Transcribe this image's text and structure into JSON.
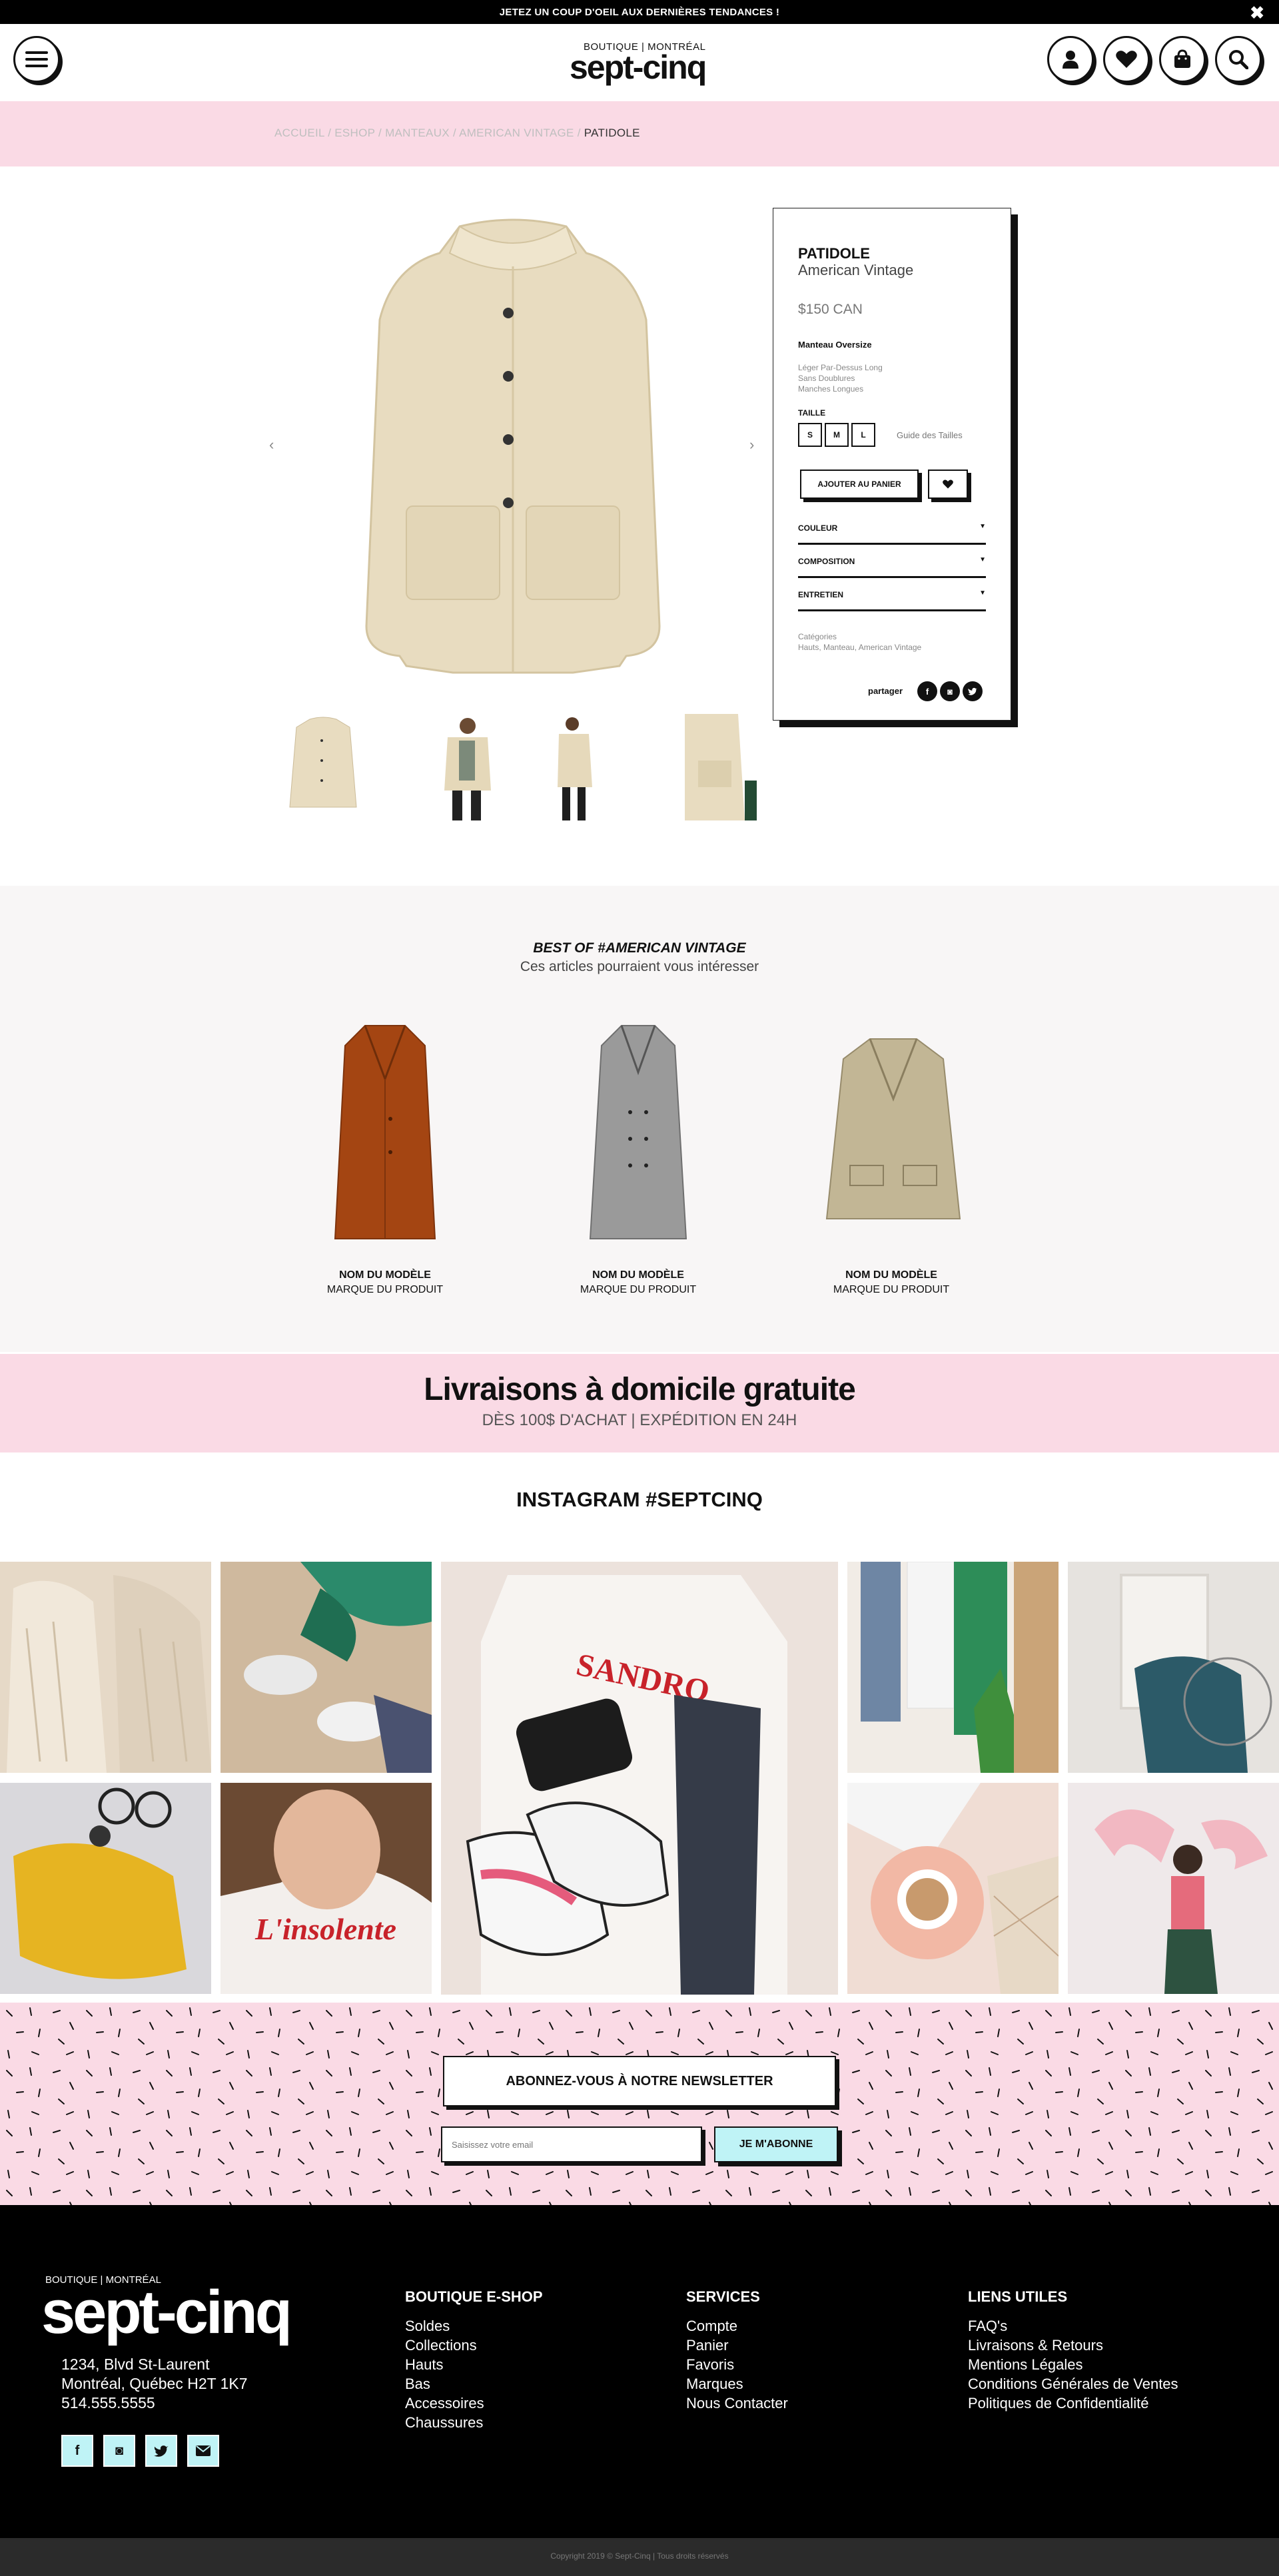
{
  "topbar": {
    "message": "JETEZ UN COUP D'OEIL AUX DERNIÈRES TENDANCES !",
    "close": "✖"
  },
  "header": {
    "logo_small": "BOUTIQUE | MONTRÉAL",
    "logo_big": "sept-cinq"
  },
  "breadcrumb": {
    "items": [
      "ACCUEIL",
      "ESHOP",
      "MANTEAUX",
      "AMERICAN VINTAGE"
    ],
    "current": "PATIDOLE",
    "sep": "/"
  },
  "product": {
    "name": "PATIDOLE",
    "brand": "American Vintage",
    "price": "$150 CAN",
    "style": "Manteau Oversize",
    "features": [
      "Léger Par-Dessus Long",
      "Sans Doublures",
      "Manches Longues"
    ],
    "size_label": "TAILLE",
    "sizes": [
      "S",
      "M",
      "L"
    ],
    "size_guide": "Guide des Tailles",
    "add_to_cart": "AJOUTER AU PANIER",
    "accordions": [
      "COULEUR",
      "COMPOSITION",
      "ENTRETIEN"
    ],
    "categories_label": "Catégories",
    "categories": "Hauts, Manteau, American Vintage",
    "share_label": "partager",
    "prev": "‹",
    "next": "›"
  },
  "best_of": {
    "title": "BEST OF #AMERICAN VINTAGE",
    "subtitle": "Ces articles pourraient vous intéresser",
    "items": [
      {
        "name": "NOM DU MODÈLE",
        "brand": "MARQUE DU PRODUIT",
        "color": "#a44512"
      },
      {
        "name": "NOM DU MODÈLE",
        "brand": "MARQUE DU PRODUIT",
        "color": "#8e8e8e"
      },
      {
        "name": "NOM DU MODÈLE",
        "brand": "MARQUE DU PRODUIT",
        "color": "#c2b695"
      }
    ]
  },
  "shipping": {
    "title": "Livraisons à domicile gratuite",
    "subtitle": "DÈS 100$ D'ACHAT |  EXPÉDITION EN 24H"
  },
  "instagram": {
    "title": "INSTAGRAM #SEPTCINQ",
    "tile_text_1": "SANDRO",
    "tile_text_2": "L'insolente"
  },
  "newsletter": {
    "title": "ABONNEZ-VOUS À NOTRE NEWSLETTER",
    "placeholder": "Saisissez votre email",
    "button": "JE M'ABONNE"
  },
  "footer": {
    "logo_small": "BOUTIQUE | MONTRÉAL",
    "logo_big": "sept-cinq",
    "address": [
      "1234,  Blvd St-Laurent",
      "Montréal, Québec H2T 1K7",
      "514.555.5555"
    ],
    "columns": [
      {
        "title": "BOUTIQUE E-SHOP",
        "links": [
          "Soldes",
          "Collections",
          "Hauts",
          "Bas",
          "Accessoires",
          "Chaussures"
        ]
      },
      {
        "title": "SERVICES",
        "links": [
          "Compte",
          "Panier",
          "Favoris",
          "Marques",
          "Nous Contacter"
        ]
      },
      {
        "title": "LIENS UTILES",
        "links": [
          "FAQ's",
          "Livraisons & Retours",
          "Mentions Légales",
          "Conditions Générales de Ventes",
          "Politiques de Confidentialité"
        ]
      }
    ],
    "social_icons": [
      "facebook-icon",
      "instagram-icon",
      "twitter-icon",
      "email-icon"
    ]
  },
  "copyright": "Copyright 2019 © Sept-Cinq | Tous droits réservés",
  "colors": {
    "pink": "#fadae5",
    "cyan": "#bff3f6",
    "black": "#000000"
  }
}
